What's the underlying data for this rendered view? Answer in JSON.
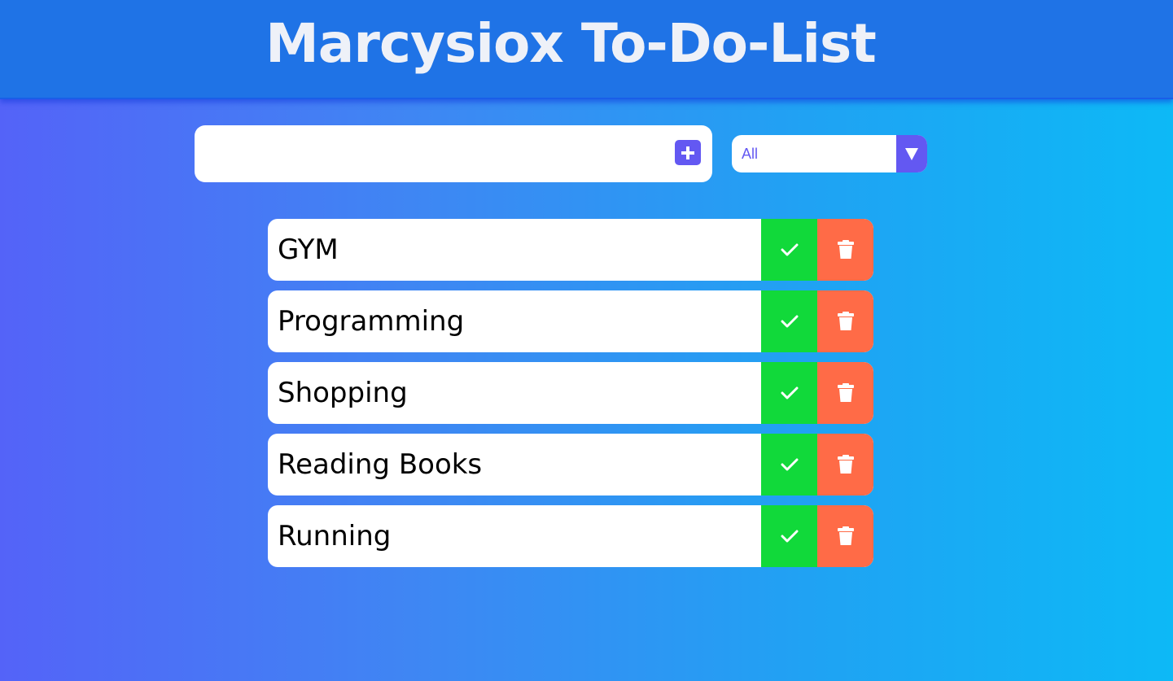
{
  "header": {
    "title": "Marcysiox To-Do-List"
  },
  "input": {
    "value": "",
    "placeholder": "",
    "add_icon": "plus-icon"
  },
  "filter": {
    "selected": "All",
    "arrow_icon": "triangle-down-icon"
  },
  "todos": [
    {
      "text": "GYM"
    },
    {
      "text": "Programming"
    },
    {
      "text": "Shopping"
    },
    {
      "text": "Reading Books"
    },
    {
      "text": "Running"
    }
  ],
  "buttons": {
    "complete_icon": "check-icon",
    "delete_icon": "trash-icon"
  },
  "colors": {
    "header": "#1f73e6",
    "accent": "#6358f2",
    "complete": "#11d93a",
    "delete": "#ff6b47",
    "gradient_start": "#5463f8",
    "gradient_end": "#0db9f6"
  }
}
